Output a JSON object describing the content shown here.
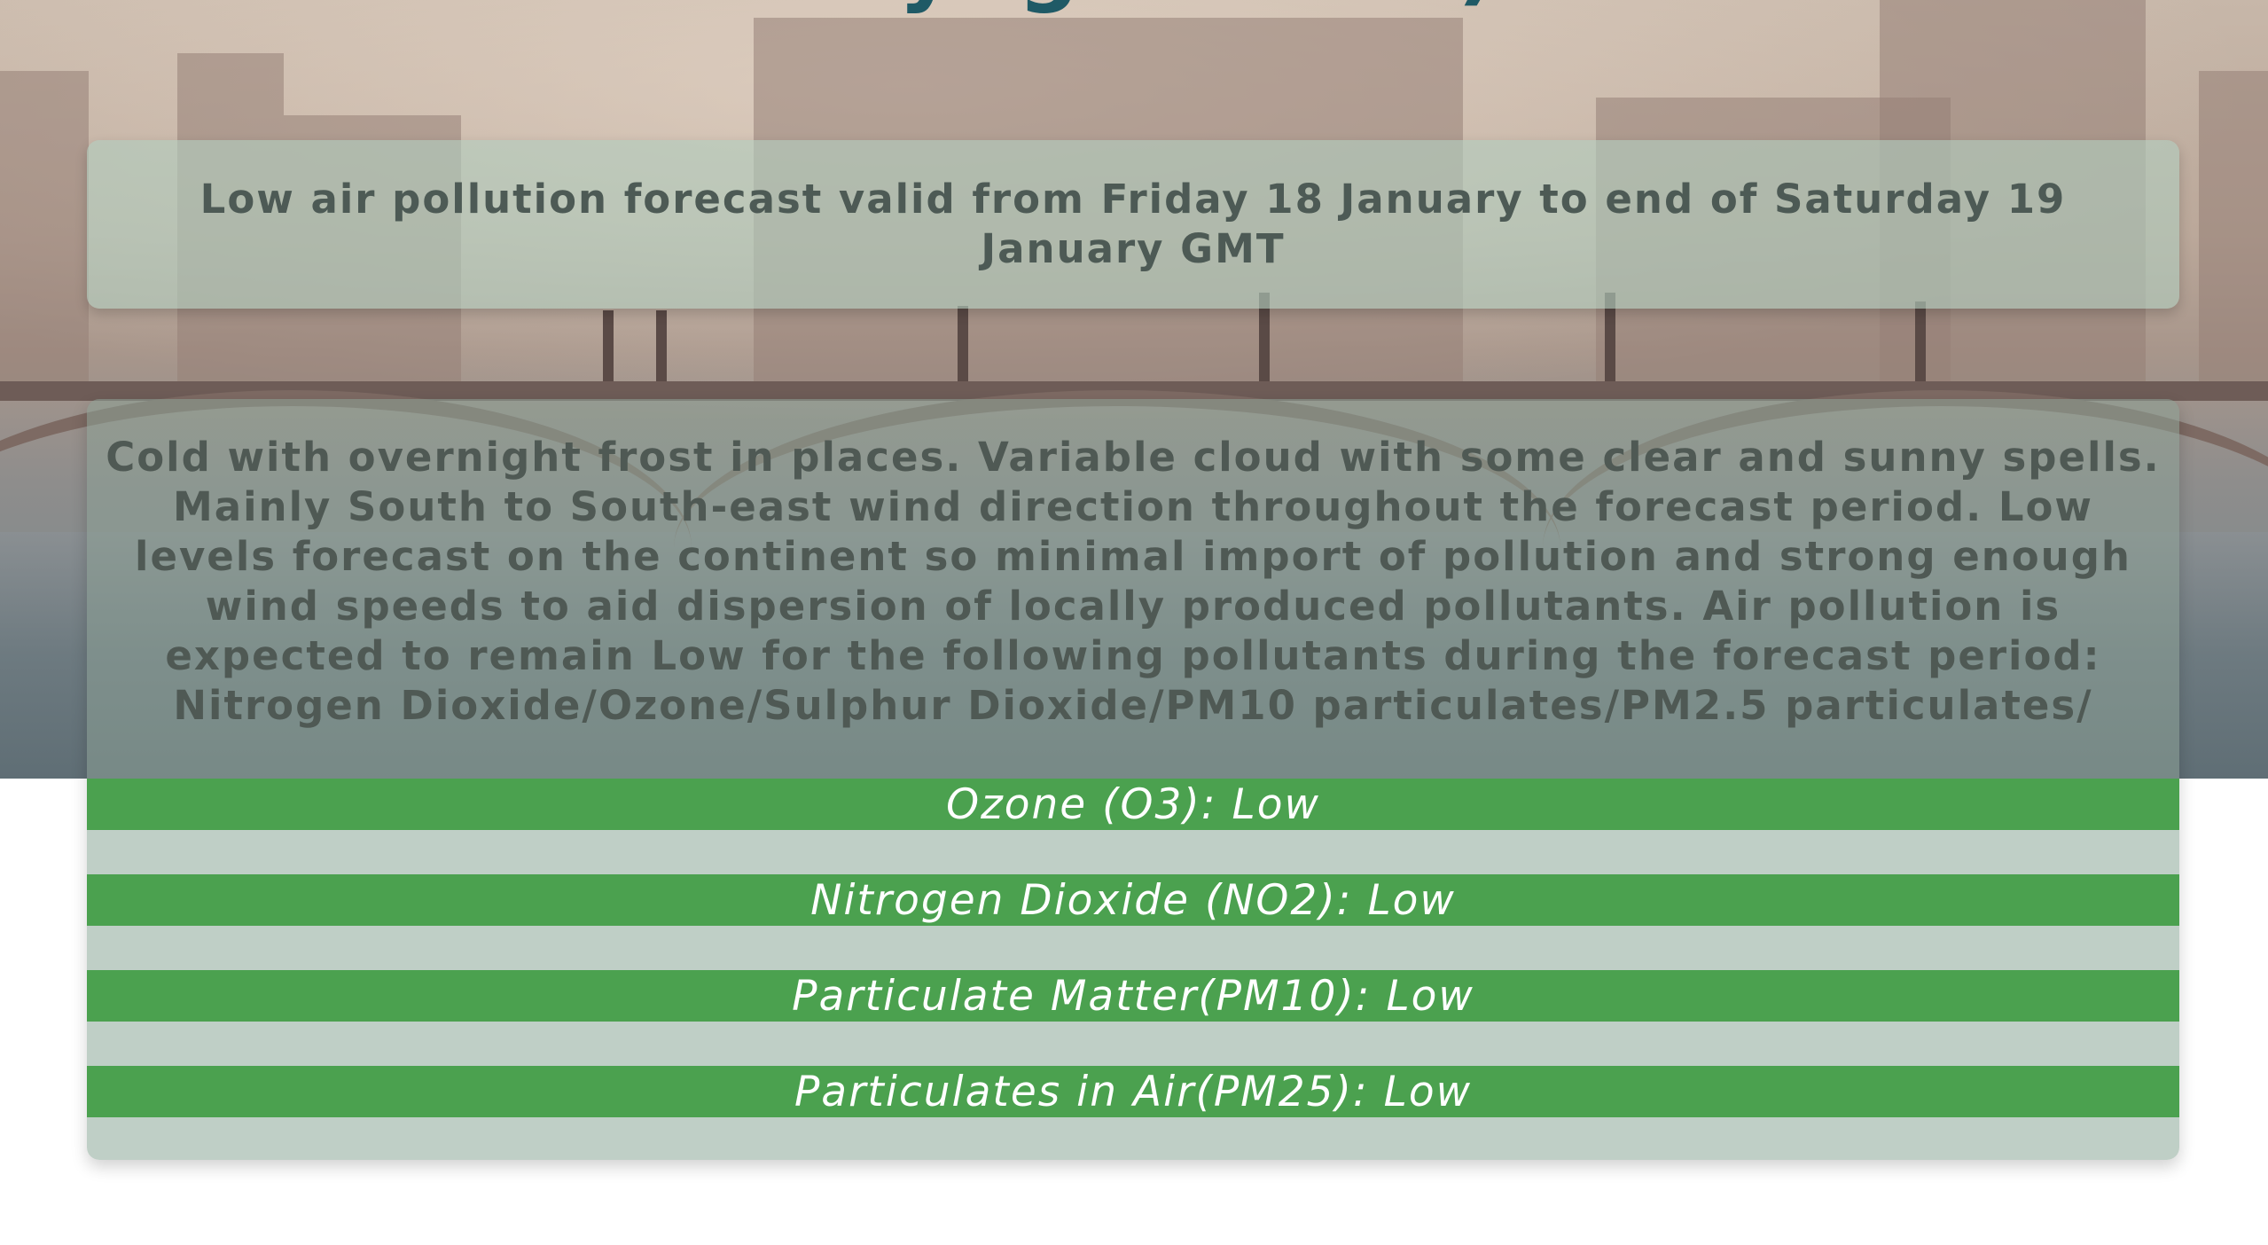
{
  "page": {
    "title": "Daylight Time)"
  },
  "validity": {
    "text": "Low air pollution forecast valid from Friday 18 January to end of Saturday 19 January GMT"
  },
  "summary": {
    "text": "Cold with overnight frost in places. Variable cloud with some clear and sunny spells. Mainly South to South-east wind direction throughout the forecast period. Low levels forecast on the continent so minimal import of pollution and strong enough wind speeds to aid dispersion of locally produced pollutants. Air pollution is expected to remain Low for the following pollutants during the forecast period: Nitrogen Dioxide/Ozone/Sulphur Dioxide/PM10 particulates/PM2.5 particulates/"
  },
  "pollutants": [
    {
      "label": "Ozone (O3): Low",
      "level": "Low"
    },
    {
      "label": "Nitrogen Dioxide (NO2): Low",
      "level": "Low"
    },
    {
      "label": "Particulate Matter(PM10): Low",
      "level": "Low"
    },
    {
      "label": "Particulates in Air(PM25): Low",
      "level": "Low"
    }
  ],
  "colors": {
    "level_low": "#4ba14f",
    "title": "#1f5a66"
  }
}
